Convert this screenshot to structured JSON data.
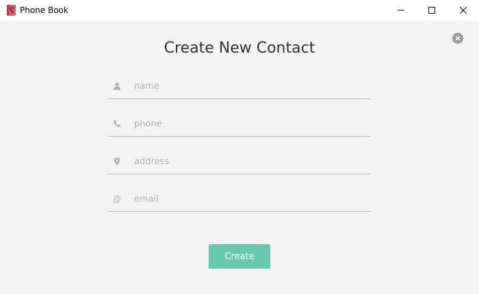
{
  "window": {
    "title": "Phone Book",
    "controls": [
      "minimize",
      "maximize",
      "close"
    ]
  },
  "form": {
    "heading": "Create New Contact",
    "fields": [
      {
        "name": "name",
        "icon": "person-icon",
        "placeholder": "name",
        "value": ""
      },
      {
        "name": "phone",
        "icon": "phone-icon",
        "placeholder": "phone",
        "value": ""
      },
      {
        "name": "address",
        "icon": "location-pin-icon",
        "placeholder": "address",
        "value": ""
      },
      {
        "name": "email",
        "icon": "at-sign-icon",
        "placeholder": "email",
        "value": ""
      }
    ],
    "submit_label": "Create",
    "dismiss_icon": "close-circle-icon"
  },
  "colors": {
    "background": "#f3f3f3",
    "titlebar": "#ffffff",
    "accent": "#66c9b0",
    "field_underline": "#b4b4b4",
    "placeholder": "#b0b0b0",
    "heading": "#333333"
  }
}
